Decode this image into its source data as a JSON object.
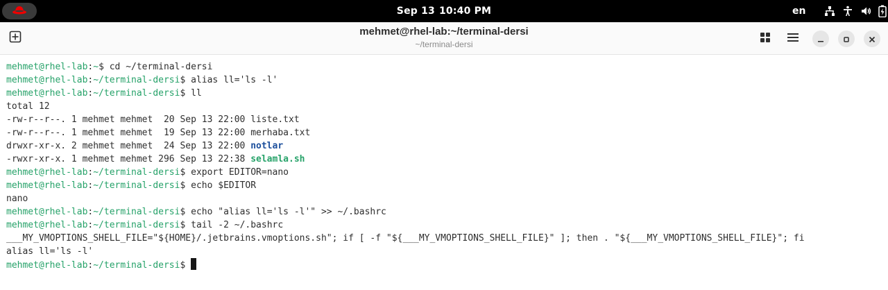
{
  "topbar": {
    "activities_icon": "redhat-icon",
    "date": "Sep 13",
    "time": "10:40 PM",
    "language": "en",
    "status_icons": [
      "network-icon",
      "accessibility-icon",
      "volume-icon",
      "battery-icon"
    ]
  },
  "window": {
    "title": "mehmet@rhel-lab:~/terminal-dersi",
    "subtitle": "~/terminal-dersi",
    "new_tab_icon": "new-tab-icon",
    "buttons": [
      "tab-overview-icon",
      "menu-icon",
      "minimize-icon",
      "maximize-icon",
      "close-icon"
    ]
  },
  "colors": {
    "prompt": "#26a269",
    "directory": "#1c4f9c",
    "executable": "#26a269",
    "text": "#2e2e2e"
  },
  "terminal": {
    "lines": [
      {
        "type": "prompt",
        "user": "mehmet@rhel-lab",
        "path": "~",
        "command": "cd ~/terminal-dersi"
      },
      {
        "type": "prompt",
        "user": "mehmet@rhel-lab",
        "path": "~/terminal-dersi",
        "command": "alias ll='ls -l'"
      },
      {
        "type": "prompt",
        "user": "mehmet@rhel-lab",
        "path": "~/terminal-dersi",
        "command": "ll"
      },
      {
        "type": "output",
        "text": "total 12"
      },
      {
        "type": "file",
        "meta": "-rw-r--r--. 1 mehmet mehmet  20 Sep 13 22:00 ",
        "name": "liste.txt",
        "kind": "plain"
      },
      {
        "type": "file",
        "meta": "-rw-r--r--. 1 mehmet mehmet  19 Sep 13 22:00 ",
        "name": "merhaba.txt",
        "kind": "plain"
      },
      {
        "type": "file",
        "meta": "drwxr-xr-x. 2 mehmet mehmet  24 Sep 13 22:00 ",
        "name": "notlar",
        "kind": "dir"
      },
      {
        "type": "file",
        "meta": "-rwxr-xr-x. 1 mehmet mehmet 296 Sep 13 22:38 ",
        "name": "selamla.sh",
        "kind": "exec"
      },
      {
        "type": "prompt",
        "user": "mehmet@rhel-lab",
        "path": "~/terminal-dersi",
        "command": "export EDITOR=nano"
      },
      {
        "type": "prompt",
        "user": "mehmet@rhel-lab",
        "path": "~/terminal-dersi",
        "command": "echo $EDITOR"
      },
      {
        "type": "output",
        "text": "nano"
      },
      {
        "type": "prompt",
        "user": "mehmet@rhel-lab",
        "path": "~/terminal-dersi",
        "command": "echo \"alias ll='ls -l'\" >> ~/.bashrc"
      },
      {
        "type": "prompt",
        "user": "mehmet@rhel-lab",
        "path": "~/terminal-dersi",
        "command": "tail -2 ~/.bashrc"
      },
      {
        "type": "output",
        "text": "___MY_VMOPTIONS_SHELL_FILE=\"${HOME}/.jetbrains.vmoptions.sh\"; if [ -f \"${___MY_VMOPTIONS_SHELL_FILE}\" ]; then . \"${___MY_VMOPTIONS_SHELL_FILE}\"; fi"
      },
      {
        "type": "output",
        "text": "alias ll='ls -l'"
      },
      {
        "type": "prompt",
        "user": "mehmet@rhel-lab",
        "path": "~/terminal-dersi",
        "command": "",
        "cursor": true
      }
    ]
  }
}
